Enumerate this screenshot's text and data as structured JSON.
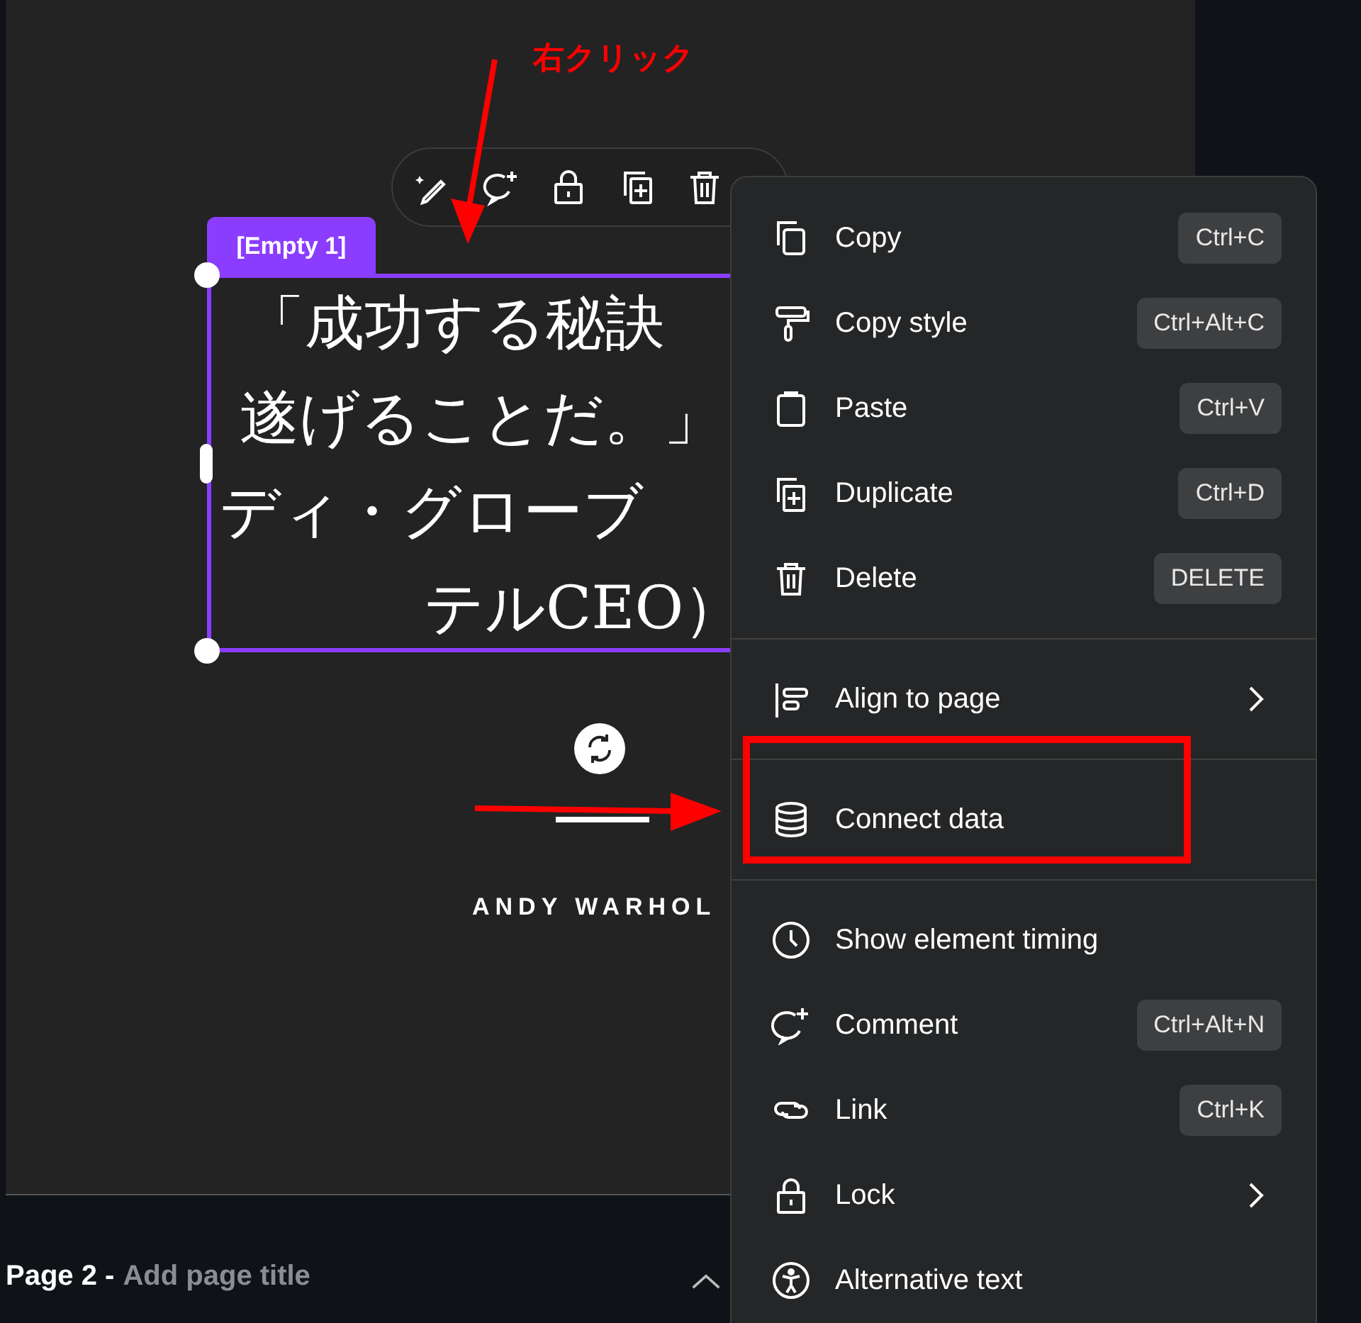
{
  "annotation": {
    "callout": "右クリック"
  },
  "canvas": {
    "tag": "[Empty 1]",
    "quote_lines": [
      "「成功する秘訣",
      "遂げることだ。」",
      "ディ・グローブ",
      "テルCEO）"
    ],
    "author": "ANDY WARHOL"
  },
  "context_menu": {
    "groups": [
      [
        {
          "kind": "shortcut",
          "label": "Copy",
          "shortcut": "Ctrl+C"
        },
        {
          "kind": "shortcut",
          "label": "Copy style",
          "shortcut": "Ctrl+Alt+C"
        },
        {
          "kind": "shortcut",
          "label": "Paste",
          "shortcut": "Ctrl+V"
        },
        {
          "kind": "shortcut",
          "label": "Duplicate",
          "shortcut": "Ctrl+D"
        },
        {
          "kind": "shortcut",
          "label": "Delete",
          "shortcut": "DELETE"
        }
      ],
      [
        {
          "kind": "submenu",
          "label": "Align to page"
        }
      ],
      [
        {
          "kind": "plain",
          "label": "Connect data"
        }
      ],
      [
        {
          "kind": "plain",
          "label": "Show element timing"
        },
        {
          "kind": "shortcut",
          "label": "Comment",
          "shortcut": "Ctrl+Alt+N"
        },
        {
          "kind": "shortcut",
          "label": "Link",
          "shortcut": "Ctrl+K"
        },
        {
          "kind": "submenu",
          "label": "Lock"
        },
        {
          "kind": "plain",
          "label": "Alternative text"
        }
      ]
    ]
  },
  "page_footer": {
    "page_label": "Page 2 -",
    "placeholder": "Add page title"
  }
}
